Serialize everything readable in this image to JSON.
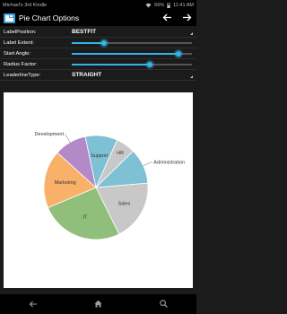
{
  "status_bar": {
    "device_name": "Michael's 3rd Kindle",
    "battery": "66%",
    "time": "11:41 AM"
  },
  "app": {
    "title": "Pie Chart Options",
    "icons": [
      "app-logo-icon",
      "arrow-left-icon",
      "arrow-right-icon"
    ]
  },
  "options": {
    "label_position": {
      "label": "LabelPosition:",
      "value": "BESTFIT"
    },
    "label_extent": {
      "label": "Label Extent:",
      "level": 0.27
    },
    "start_angle": {
      "label": "Start Angle:",
      "level": 0.89
    },
    "radius_factor": {
      "label": "Radius Factor:",
      "level": 0.65
    },
    "leaderline_type": {
      "label": "LeaderlineType:",
      "value": "STRAIGHT"
    }
  },
  "chart_data": {
    "type": "pie",
    "slices": [
      {
        "label": "Support",
        "value": 10,
        "color": "#7ec0d4"
      },
      {
        "label": "HR",
        "value": 6,
        "color": "#c8c8c8"
      },
      {
        "label": "Administration",
        "value": 11,
        "color": "#7ec0d4"
      },
      {
        "label": "Sales",
        "value": 19,
        "color": "#c8c8c8"
      },
      {
        "label": "IT",
        "value": 26,
        "color": "#8fbf7a"
      },
      {
        "label": "Marketing",
        "value": 18,
        "color": "#f9b16a"
      },
      {
        "label": "Development",
        "value": 10,
        "color": "#b28ac8"
      }
    ],
    "start_angle_deg": -102
  },
  "nav": {
    "icons": [
      "back-icon",
      "home-icon",
      "search-icon"
    ]
  },
  "colors": {
    "accent": "#33b5e5",
    "background": "#1b1b1b"
  }
}
